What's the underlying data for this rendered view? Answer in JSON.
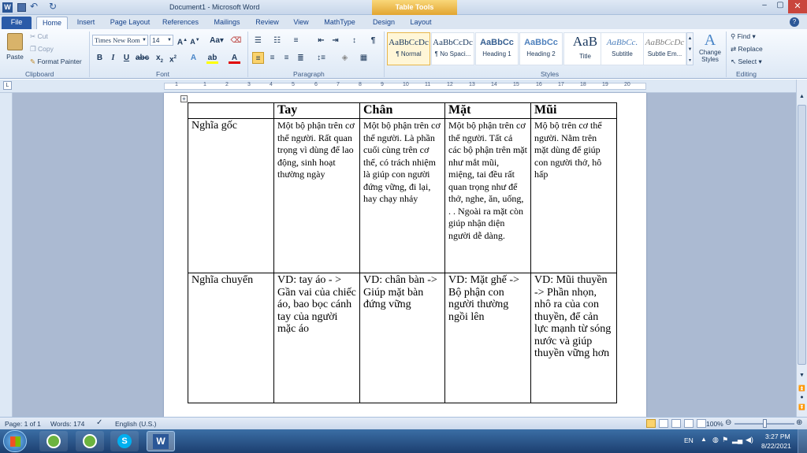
{
  "titlebar": {
    "title": "Document1  -  Microsoft Word",
    "context_tab_group": "Table Tools"
  },
  "tabs": [
    "File",
    "Home",
    "Insert",
    "Page Layout",
    "References",
    "Mailings",
    "Review",
    "View",
    "MathType",
    "Design",
    "Layout"
  ],
  "clipboard": {
    "paste": "Paste",
    "cut": "Cut",
    "copy": "Copy",
    "format_painter": "Format Painter",
    "label": "Clipboard"
  },
  "font": {
    "name": "Times New Rom",
    "size": "14",
    "label": "Font"
  },
  "paragraph": {
    "label": "Paragraph"
  },
  "styles": {
    "label": "Styles",
    "items": [
      {
        "preview": "AaBbCcDc",
        "name": "¶ Normal"
      },
      {
        "preview": "AaBbCcDc",
        "name": "¶ No Spaci..."
      },
      {
        "preview": "AaBbCc",
        "name": "Heading 1"
      },
      {
        "preview": "AaBbCc",
        "name": "Heading 2"
      },
      {
        "preview": "AaB",
        "name": "Title"
      },
      {
        "preview": "AaBbCc.",
        "name": "Subtitle"
      },
      {
        "preview": "AaBbCcDc",
        "name": "Subtle Em..."
      }
    ],
    "change_styles": "Change Styles"
  },
  "editing": {
    "find": "Find",
    "replace": "Replace",
    "select": "Select",
    "label": "Editing"
  },
  "ruler_marks": [
    "1",
    "1",
    "2",
    "3",
    "4",
    "5",
    "6",
    "7",
    "8",
    "9",
    "10",
    "11",
    "12",
    "13",
    "14",
    "15",
    "16",
    "17",
    "18",
    "19",
    "20"
  ],
  "table": {
    "headers": [
      "",
      "Tay",
      "Chân",
      "Mặt",
      "Mũi"
    ],
    "rows": [
      {
        "label": "Nghĩa gốc",
        "cells": [
          "Một bộ phận trên cơ thể người. Rất quan trọng vì dùng để lao động, sinh hoạt thường ngày",
          "Một bộ phận trên cơ thể người. Là phần cuối cùng trên cơ thể, có trách nhiệm là giúp con người đứng vững, đi lại, hay chạy nhảy",
          "Một bộ phận trên cơ thể người. Tất cả các bộ phận trên mặt như mắt mũi, miệng, tai đều rất quan trọng như để thở, nghe, ăn, uống, . . Ngoài ra mặt còn giúp nhận diện người dễ dàng.",
          "Mộ bộ trên cơ thể người. Nằm trên mặt dùng để giúp con người thở, hô hấp"
        ]
      },
      {
        "label": "Nghĩa chuyển",
        "cells": [
          "VD: tay áo - > Gần vai của chiếc áo, bao bọc cánh tay của người mặc áo",
          "VD: chân bàn -> Giúp mặt bàn đứng vững",
          "VD: Mặt ghế -> Bộ phận con người thường ngồi lên",
          "VD: Mũi thuyền -> Phần nhọn, nhô ra của con thuyền, để cản lực mạnh từ sóng nước và giúp thuyền vững hơn"
        ]
      }
    ]
  },
  "status": {
    "page": "Page: 1 of 1",
    "words": "Words: 174",
    "language": "English (U.S.)",
    "zoom": "100%"
  },
  "taskbar": {
    "lang": "EN",
    "time": "3:27 PM",
    "date": "8/22/2021"
  },
  "colors": {
    "ribbon": "#dde8f5",
    "tab_file": "#2a5ba8",
    "taskbar": "#2a5288",
    "context": "#e2a530"
  }
}
